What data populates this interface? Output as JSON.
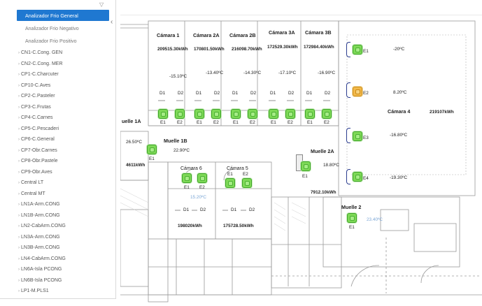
{
  "sidebar": {
    "active": "Analizador Frio General",
    "subs": [
      "Analizador Frio Negativo",
      "Analizador Frio Positivo"
    ],
    "items": [
      "CN1-C.Cong. GEN",
      "CN2-C.Cong. MER",
      "CP1-C.Charcuter",
      "CP10-C.Aves",
      "CP2-C.Pasteler",
      "CP3-C.Frutas",
      "CP4-C.Carnes",
      "CP5-C.Pescaderi",
      "CP6-C.General",
      "CP7-Obr.Carnes",
      "CP8-Obr.Pastele",
      "CP9-Obr.Aves",
      "Central LT",
      "Central MT",
      "LN1A-Arm.CONG",
      "LN1B-Arm.CONG",
      "LN2-CabArm.CONG",
      "LN3A-Arm.CONG",
      "LN3B-Arm.CONG",
      "LN4-CabArm.CONG",
      "LN6A-Isla PCONG",
      "LN6B-Isla PCONG",
      "LP1-M.PLS1"
    ]
  },
  "camaras_top": [
    {
      "name": "Cámara 1",
      "kwh": "209515.30kWh",
      "temp": "-15.10ºC"
    },
    {
      "name": "Cámara 2A",
      "kwh": "170801.50kWh",
      "temp": "-13.40ºC"
    },
    {
      "name": "Cámara 2B",
      "kwh": "216098.70kWh",
      "temp": "-14.30ºC"
    },
    {
      "name": "Cámara 3A",
      "kwh": "172529.30kWh",
      "temp": "-17.10ºC"
    },
    {
      "name": "Cámara 3B",
      "kwh": "172984.40kWh",
      "temp": "-16.90ºC"
    }
  ],
  "labels": {
    "d1": "D1",
    "d2": "D2",
    "e1": "E1",
    "e2": "E2",
    "e3": "E3",
    "e4": "E4"
  },
  "camara4": {
    "name": "Cámara 4",
    "kwh": "219107kWh",
    "t1": "-20ºC",
    "t2": "8.20ºC",
    "t3": "-16.80ºC",
    "t4": "-19.30ºC"
  },
  "muelle1a": {
    "name": "uelle 1A",
    "temp": "26.50ºC",
    "kwh": "4611kWh"
  },
  "muelle1b": {
    "name": "Muelle 1B",
    "temp": "22.90ºC"
  },
  "muelle2a": {
    "name": "Muelle 2A",
    "temp": "18.80ºC",
    "kwh": "7912.10kWh"
  },
  "muelle2": {
    "name": "Muelle 2",
    "temp": "23.40ºC"
  },
  "camara6": {
    "name": "Cámara 6",
    "temp": "15.20ºC",
    "kwh": "198020kWh"
  },
  "camara5": {
    "name": "Cámara 5",
    "kwh": "175728.50kWh"
  },
  "colors": {
    "accent": "#1f78d1",
    "sensor_ok": "#7ed957",
    "sensor_warn": "#f2b94a",
    "door": "#2b3d8f"
  }
}
